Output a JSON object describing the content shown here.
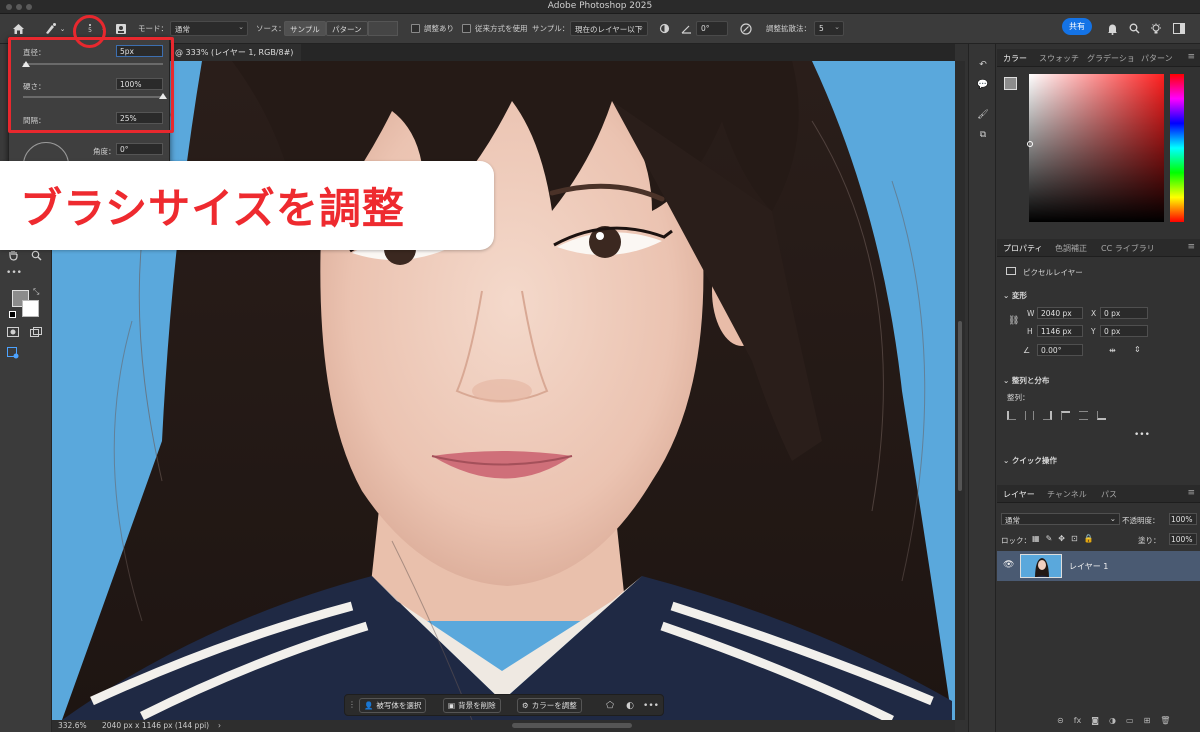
{
  "app": {
    "title": "Adobe Photoshop 2025"
  },
  "options_bar": {
    "brush_size_badge": "5",
    "mode_label": "モード：",
    "mode_value": "通常",
    "source_label": "ソース：",
    "source_sampled": "サンプル",
    "source_pattern": "パターン",
    "aligned_label": "調整あり",
    "legacy_label": "従来方式を使用",
    "sample_label": "サンプル：",
    "sample_value": "現在のレイヤー以下",
    "angle_value": "0°",
    "diffusion_label": "調整拡散法：",
    "diffusion_value": "5",
    "share_label": "共有"
  },
  "brush_popup": {
    "diameter_label": "直径：",
    "diameter_value": "5px",
    "diameter_level": 0.02,
    "hardness_label": "硬さ：",
    "hardness_value": "100%",
    "hardness_level": 1.0,
    "spacing_label": "間隔：",
    "spacing_value": "25%",
    "angle_label": "角度：",
    "angle_value": "0°"
  },
  "document_tab": {
    "label": "@ 333% (レイヤー 1, RGB/8#)"
  },
  "annotation": {
    "text": "ブラシサイズを調整"
  },
  "status_bar": {
    "zoom": "332.6%",
    "doc_info": "2040 px x 1146 px (144 ppi)"
  },
  "task_bar": {
    "select_subject": "被写体を選択",
    "remove_background": "背景を削除",
    "adjust_color": "カラーを調整"
  },
  "color_panel": {
    "tabs": [
      "カラー",
      "スウォッチ",
      "グラデーショ",
      "パターン"
    ]
  },
  "properties_panel": {
    "tabs": [
      "プロパティ",
      "色調補正",
      "CC ライブラリ"
    ],
    "layer_type": "ピクセルレイヤー",
    "transform_label": "変形",
    "w_label": "W",
    "w_value": "2040 px",
    "h_label": "H",
    "h_value": "1146 px",
    "x_label": "X",
    "x_value": "0 px",
    "y_label": "Y",
    "y_value": "0 px",
    "angle_value": "0.00°",
    "align_label": "整列と分布",
    "align_sub": "整列：",
    "quick_actions": "クイック操作"
  },
  "layers_panel": {
    "tabs": [
      "レイヤー",
      "チャンネル",
      "パス"
    ],
    "blend_mode": "通常",
    "opacity_label": "不透明度：",
    "opacity_value": "100%",
    "lock_label": "ロック：",
    "fill_label": "塗り：",
    "fill_value": "100%",
    "layers": [
      {
        "name": "レイヤー 1"
      }
    ]
  },
  "colors": {
    "accent_blue": "#1473e6",
    "annotation_red": "#e8282e",
    "canvas_bg": "#5aa8dc"
  }
}
